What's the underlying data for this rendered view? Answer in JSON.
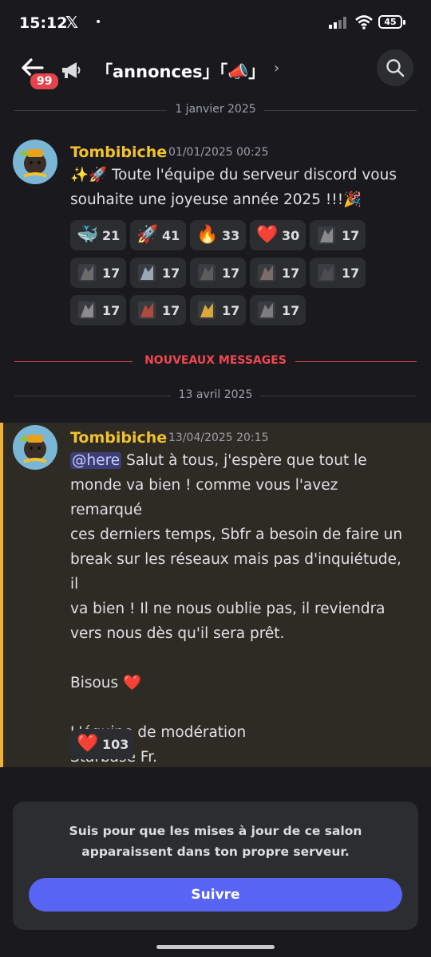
{
  "status_bar": {
    "time": "15:12",
    "x_logo": "𝕏",
    "dot": "•",
    "battery": "45"
  },
  "header": {
    "badge_count": "99",
    "channel_title": "「annonces」「📣」",
    "chevron": "›"
  },
  "date_divider_1": "1 janvier 2025",
  "message_1": {
    "author": "Tombibiche",
    "timestamp": "01/01/2025 00:25",
    "text_line1": "✨🚀 Toute l'équipe du serveur discord vous",
    "text_line2": "souhaite une joyeuse année 2025 !!!🎉",
    "reactions": [
      {
        "emoji": "🐳",
        "icon": "whale-emoji",
        "count": "21"
      },
      {
        "emoji": "🚀",
        "icon": "rocket-emoji",
        "count": "41"
      },
      {
        "emoji": "🔥",
        "icon": "fire-emoji",
        "count": "33"
      },
      {
        "emoji": "❤️",
        "icon": "heart-emoji",
        "count": "30"
      },
      {
        "emoji": "",
        "icon": "custom-emoji-1",
        "count": "17"
      },
      {
        "emoji": "",
        "icon": "custom-emoji-2",
        "count": "17"
      },
      {
        "emoji": "",
        "icon": "custom-emoji-3",
        "count": "17"
      },
      {
        "emoji": "",
        "icon": "custom-emoji-4",
        "count": "17"
      },
      {
        "emoji": "",
        "icon": "custom-emoji-5",
        "count": "17"
      },
      {
        "emoji": "",
        "icon": "custom-emoji-6",
        "count": "17"
      },
      {
        "emoji": "",
        "icon": "custom-emoji-7",
        "count": "17"
      },
      {
        "emoji": "",
        "icon": "custom-emoji-8",
        "count": "17"
      },
      {
        "emoji": "",
        "icon": "custom-emoji-9",
        "count": "17"
      },
      {
        "emoji": "",
        "icon": "custom-emoji-10",
        "count": "17"
      }
    ]
  },
  "new_messages_label": "NOUVEAUX MESSAGES",
  "date_divider_2": "13 avril 2025",
  "message_2": {
    "author": "Tombibiche",
    "timestamp": "13/04/2025 20:15",
    "mention": "@here",
    "line1": " Salut à tous, j'espère que tout le",
    "line2": "monde va bien ! comme vous l'avez remarqué",
    "line3": "ces derniers temps, Sbfr a besoin de faire un",
    "line4": "break sur les réseaux mais pas d'inquiétude, il",
    "line5": "va bien ! Il ne nous oublie pas, il reviendra",
    "line6": "vers nous dès qu'il sera prêt.",
    "line7": "Bisous ❤️",
    "line8": "L'équipe de modération",
    "line9": "Starbase Fr.",
    "reaction": {
      "emoji": "❤️",
      "icon": "heart-emoji",
      "count": "103"
    }
  },
  "follow_card": {
    "text": "Suis pour que les mises à jour de ce salon apparaissent dans ton propre serveur.",
    "button": "Suivre"
  },
  "colors": {
    "accent": "#5865f2",
    "author": "#f0c22e",
    "new_messages": "#f0474f",
    "highlight_bar": "#f0b232"
  }
}
